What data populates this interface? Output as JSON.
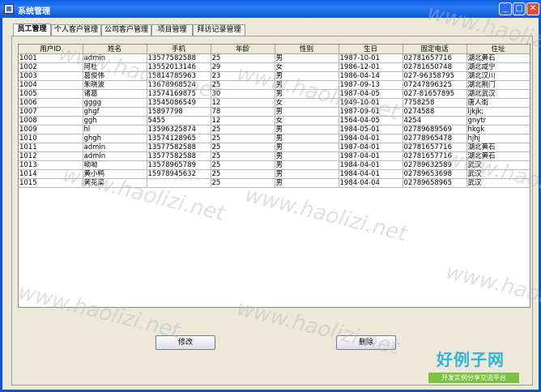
{
  "window": {
    "title": "系统管理",
    "minimize": "_",
    "maximize": "□",
    "close": "✕"
  },
  "tabs": [
    {
      "label": "员工管理",
      "active": true
    },
    {
      "label": "个人客户管理",
      "active": false
    },
    {
      "label": "公司客户管理",
      "active": false
    },
    {
      "label": "项目管理",
      "active": false
    },
    {
      "label": "拜访记录管理",
      "active": false
    }
  ],
  "table": {
    "columns": [
      "用户ID",
      "姓名",
      "手机",
      "年龄",
      "性别",
      "生日",
      "固定电话",
      "住址"
    ],
    "rows": [
      [
        "1001",
        "admin",
        "13577582588",
        "25",
        "男",
        "1987-10-01",
        "02781657716",
        "湖北黄石"
      ],
      [
        "1002",
        "阿杜",
        "13552013146",
        "29",
        "女",
        "1986-12-01",
        "02781650748",
        "湖北咸宁"
      ],
      [
        "1003",
        "葛俊伟",
        "15814785963",
        "23",
        "男",
        "1986-04-14",
        "027-96358795",
        "湖北汉川"
      ],
      [
        "1004",
        "朱晓波",
        "13678968524",
        "25",
        "男",
        "1987-09-13",
        "07247896325",
        "湖北荆门"
      ],
      [
        "1005",
        "诸葛",
        "13574169875",
        "30",
        "男",
        "1987-04-05",
        "027-81657895",
        "湖北武汉"
      ],
      [
        "1006",
        "gggg",
        "13545086549",
        "12",
        "女",
        "1949-10-01",
        "7758258",
        "唐人街"
      ],
      [
        "1007",
        "ghgf",
        "15897798",
        "78",
        "男",
        "1987-09-01",
        "0274588",
        "ljkjk;"
      ],
      [
        "1008",
        "ggh",
        "5455",
        "12",
        "女",
        "1564-04-05",
        "4254",
        "gnytr"
      ],
      [
        "1009",
        "hl",
        "13596325874",
        "25",
        "男",
        "1984-05-01",
        "02789689569",
        "hkgk"
      ],
      [
        "1010",
        "ghgh",
        "13574128965",
        "25",
        "男",
        "1984-04-01",
        "02778965478",
        "hjhj"
      ],
      [
        "1011",
        "admin",
        "13577582588",
        "25",
        "男",
        "1987-04-01",
        "02781657716",
        "湖北黄石"
      ],
      [
        "1012",
        "admin",
        "13577582588",
        "25",
        "男",
        "1987-04-01",
        "02781657716",
        "湖北黄石"
      ],
      [
        "1013",
        "呦呦",
        "13578965789",
        "25",
        "男",
        "1984-04-01",
        "02789632589",
        "武汉"
      ],
      [
        "1014",
        "黄小鸭",
        "15978945632",
        "25",
        "男",
        "1984-04-01",
        "02789653698",
        "武汉"
      ],
      [
        "1015",
        "黄花菜",
        "",
        "25",
        "男",
        "1984-04-04",
        "02789658965",
        "武汉"
      ]
    ]
  },
  "buttons": {
    "modify": "修改",
    "delete": "删除"
  },
  "watermark": {
    "text": "www.haolizi.net"
  },
  "logo": {
    "main": "好例子网",
    "sub": "开发实例分享交流平台"
  },
  "colors": {
    "titlebar": "#0a5fe0",
    "logo_text": "#2fb4dc",
    "logo_band": "#7cc242"
  }
}
